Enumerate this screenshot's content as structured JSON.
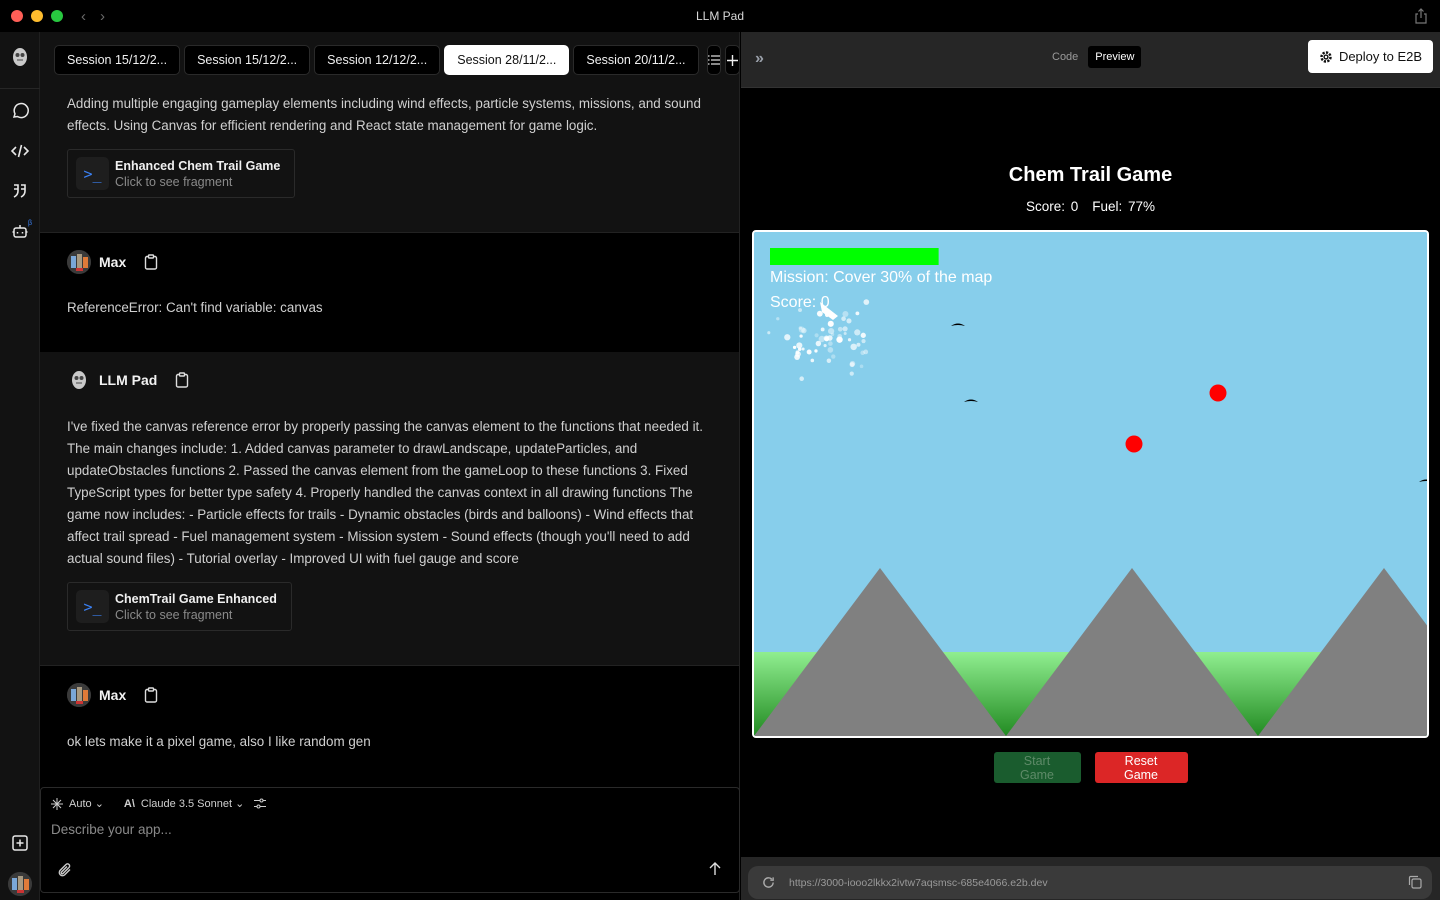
{
  "window": {
    "title": "LLM Pad",
    "traffic_colors": {
      "close": "#ff5f57",
      "minimize": "#febc2e",
      "maximize": "#28c840"
    }
  },
  "rail": {
    "items": [
      {
        "icon": "chat-bubble-icon"
      },
      {
        "icon": "code-icon"
      },
      {
        "icon": "quote-icon"
      },
      {
        "icon": "robot-icon",
        "badge": "β"
      }
    ],
    "bottom": [
      {
        "icon": "new-chat-icon"
      },
      {
        "icon": "user-avatar"
      }
    ]
  },
  "tabs": [
    {
      "label": "Session 15/12/2...",
      "active": false
    },
    {
      "label": "Session 15/12/2...",
      "active": false
    },
    {
      "label": "Session 12/12/2...",
      "active": false
    },
    {
      "label": "Session 28/11/2...",
      "active": true
    },
    {
      "label": "Session 20/11/2...",
      "active": false
    }
  ],
  "messages": [
    {
      "role": "assistant",
      "text": "Adding multiple engaging gameplay elements including wind effects, particle systems, missions, and sound effects. Using Canvas for efficient rendering and React state management for game logic.",
      "fragment": {
        "title": "Enhanced Chem Trail Game",
        "subtitle": "Click to see fragment"
      }
    },
    {
      "role": "user",
      "author": "Max",
      "text": "ReferenceError: Can't find variable: canvas"
    },
    {
      "role": "assistant",
      "author": "LLM Pad",
      "text": "I've fixed the canvas reference error by properly passing the canvas element to the functions that needed it. The main changes include: 1. Added canvas parameter to drawLandscape, updateParticles, and updateObstacles functions 2. Passed the canvas element from the gameLoop to these functions 3. Fixed TypeScript types for better type safety 4. Properly handled the canvas context in all drawing functions The game now includes: - Particle effects for trails - Dynamic obstacles (birds and balloons) - Wind effects that affect trail spread - Fuel management system - Mission system - Sound effects (though you'll need to add actual sound files) - Tutorial overlay - Improved UI with fuel gauge and score",
      "fragment": {
        "title": "ChemTrail Game Enhanced",
        "subtitle": "Click to see fragment"
      }
    },
    {
      "role": "user",
      "author": "Max",
      "text": "ok lets make it a pixel game, also I like random gen"
    }
  ],
  "composer": {
    "mode": "Auto",
    "model": "Claude 3.5 Sonnet",
    "placeholder": "Describe your app...",
    "value": ""
  },
  "preview": {
    "toggle": {
      "code": "Code",
      "preview": "Preview",
      "selected": "Preview"
    },
    "deploy_label": "Deploy to E2B",
    "game": {
      "title": "Chem Trail Game",
      "score_label": "Score: 0",
      "fuel_label": "Fuel: 77%",
      "fuel_percent": 77,
      "mission_text": "Mission: Cover 30% of the map",
      "canvas_score_text": "Score: 0",
      "colors": {
        "sky": "#87ceeb",
        "mountain": "#808080",
        "grass_top": "#90ee90",
        "grass_bottom": "#228b22",
        "fuel_bar": "#00ff00",
        "balloon": "#ff0000",
        "bird": "#000000"
      },
      "start_label": "Start Game",
      "reset_label": "Reset Game"
    },
    "url": "https://3000-iooo2lkkx2ivtw7aqsmsc-685e4066.e2b.dev"
  }
}
